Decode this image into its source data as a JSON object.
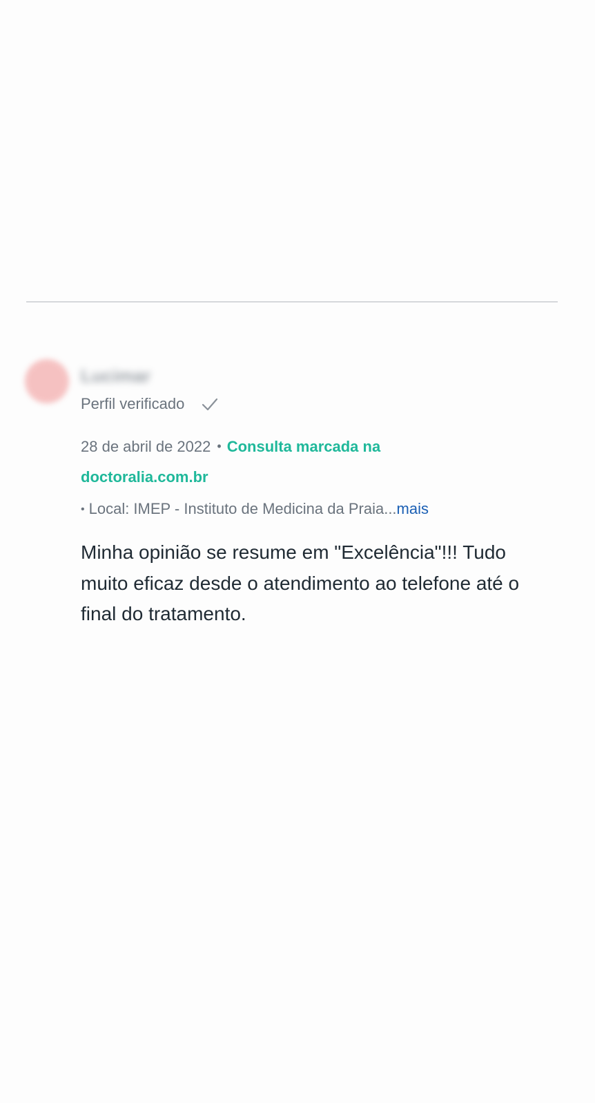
{
  "review": {
    "reviewer_name": "Lucimar",
    "verified_label": "Perfil verificado",
    "date": "28 de abril de 2022",
    "separator": "•",
    "booked_prefix": "Consulta marcada na",
    "booked_site": "doctoralia.com.br",
    "location_bullet": "•",
    "location_text": "Local: IMEP - Instituto de Medicina da Praia...",
    "more_label": "mais",
    "text": "Minha opinião se resume em \"Excelência\"!!! Tudo muito eficaz desde o atendimento ao telefone até o final do tratamento."
  },
  "colors": {
    "accent_green": "#1fb89a",
    "link_blue": "#1a5fb4",
    "muted_gray": "#6a737d",
    "avatar_pink": "#f4b3b3"
  },
  "icons": {
    "verified": "check-icon"
  }
}
